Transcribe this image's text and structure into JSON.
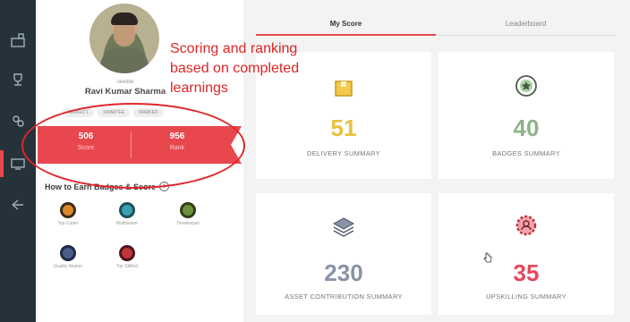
{
  "profile": {
    "role": "newbie",
    "name": "Ravi Kumar Sharma",
    "tags": [
      "MANGO 1",
      "SMARTEE",
      "MARKED"
    ],
    "score_value": "506",
    "score_label": "Score",
    "rank_value": "956",
    "rank_label": "Rank",
    "earn_title": "How to Earn Badges & Score",
    "info_glyph": "i"
  },
  "badges": [
    {
      "label": "Top Coder",
      "color": "#d9892b"
    },
    {
      "label": "Multitasker",
      "color": "#3a9fb2"
    },
    {
      "label": "Timekeeper",
      "color": "#6f8f3a"
    },
    {
      "label": "Quality Master",
      "color": "#4b5c8c"
    },
    {
      "label": "Top Skilled",
      "color": "#c0353b"
    }
  ],
  "tabs": [
    {
      "label": "My Score",
      "active": true
    },
    {
      "label": "Leaderboard",
      "active": false
    }
  ],
  "cards": [
    {
      "value": "51",
      "title": "DELIVERY SUMMARY",
      "color": "#e8c23a"
    },
    {
      "value": "40",
      "title": "BADGES SUMMARY",
      "color": "#8db38a"
    },
    {
      "value": "230",
      "title": "ASSET CONTRIBUTION SUMMARY",
      "color": "#8a92a8"
    },
    {
      "value": "35",
      "title": "UPSKILLING SUMMARY",
      "color": "#e5485a"
    }
  ],
  "annotation": {
    "line1": "Scoring and ranking",
    "line2": "based on completed",
    "line3": "learnings",
    "color": "#e02525"
  },
  "nav": [
    "dashboard-icon",
    "trophy-icon",
    "group-icon",
    "monitor-icon",
    "share-icon"
  ],
  "accent": "#e9474e"
}
